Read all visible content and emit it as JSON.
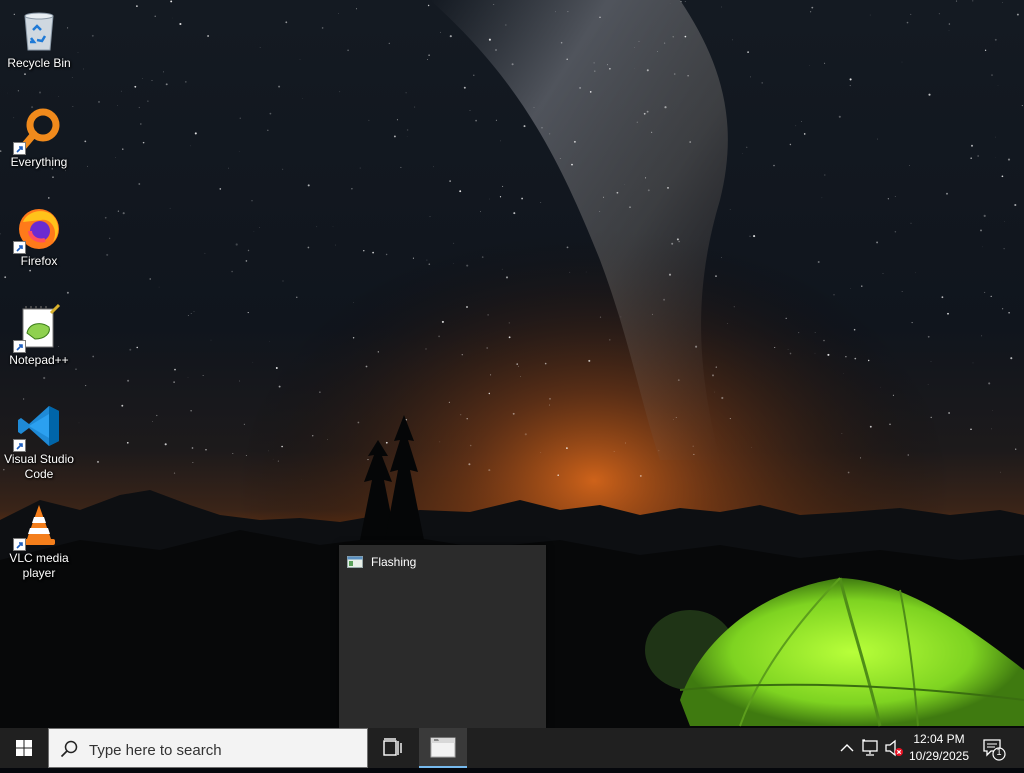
{
  "desktop": {
    "icons": [
      {
        "label": "Recycle Bin",
        "icon": "recycle-bin-icon",
        "shortcut": false
      },
      {
        "label": "Everything",
        "icon": "everything-search-icon",
        "shortcut": true
      },
      {
        "label": "Firefox",
        "icon": "firefox-icon",
        "shortcut": true
      },
      {
        "label": "Notepad++",
        "icon": "notepad-plus-plus-icon",
        "shortcut": true
      },
      {
        "label": "Visual Studio Code",
        "icon": "vscode-icon",
        "shortcut": true
      },
      {
        "label": "VLC media player",
        "icon": "vlc-cone-icon",
        "shortcut": true
      }
    ]
  },
  "preview": {
    "title": "Flashing",
    "icon": "window-app-icon"
  },
  "taskbar": {
    "start_icon": "windows-logo-icon",
    "search_placeholder": "Type here to search",
    "task_view_icon": "task-view-icon",
    "active_app_icon": "flashing-app-icon",
    "accent": "#76b9ed"
  },
  "tray": {
    "icons": [
      "chevron-up-icon",
      "network-icon",
      "volume-muted-icon"
    ],
    "time": "12:04 PM",
    "date": "10/29/2025",
    "notification_count": "1"
  }
}
